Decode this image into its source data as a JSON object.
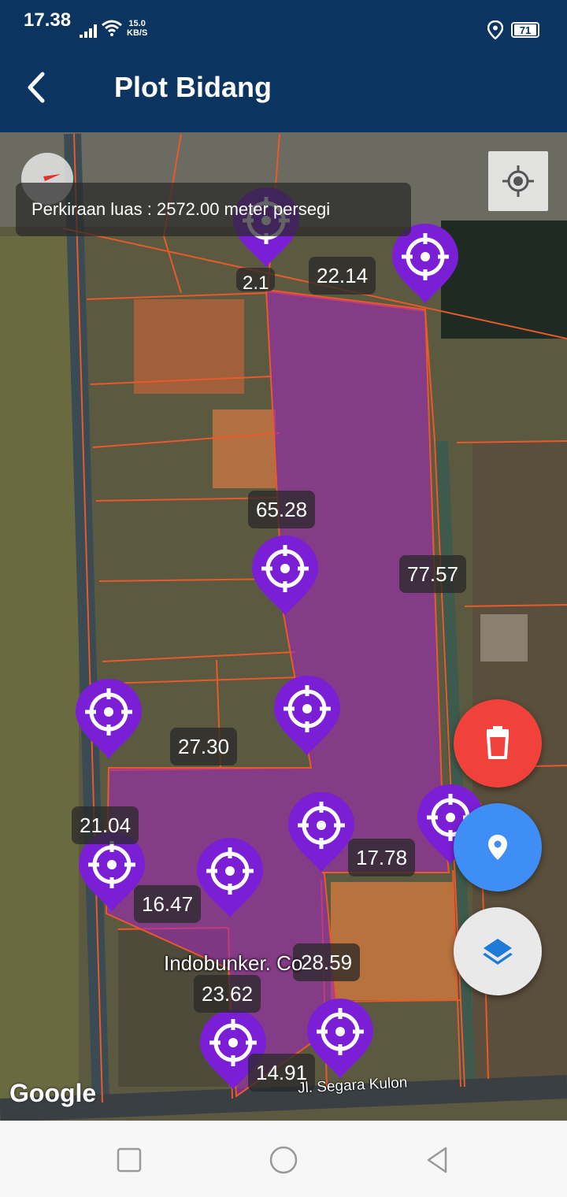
{
  "status_bar": {
    "time": "17.38",
    "net_speed_value": "15.0",
    "net_speed_unit": "KB/S",
    "battery": "71"
  },
  "app_bar": {
    "title": "Plot Bidang"
  },
  "map": {
    "area_estimate": "Perkiraan luas : 2572.00 meter persegi",
    "distance_labels": [
      "22.14",
      "65.28",
      "77.57",
      "27.30",
      "21.04",
      "16.47",
      "17.78",
      "28.59",
      "23.62",
      "14.91"
    ],
    "partial_label": "2.1",
    "poi_label": "Indobunker. Co",
    "road_label": "Jl. Segara Kulon",
    "attribution": "Google",
    "colors": {
      "polygon_fill": "#9b2fae",
      "pin": "#7b1fd6",
      "parcel_border": "#e85a2a"
    }
  },
  "fabs": {
    "delete_icon": "trash-icon",
    "marker_icon": "location-pin-icon",
    "layers_icon": "layers-icon"
  },
  "nav_bar": {
    "icons": [
      "recent-apps-icon",
      "home-icon",
      "back-icon"
    ]
  }
}
